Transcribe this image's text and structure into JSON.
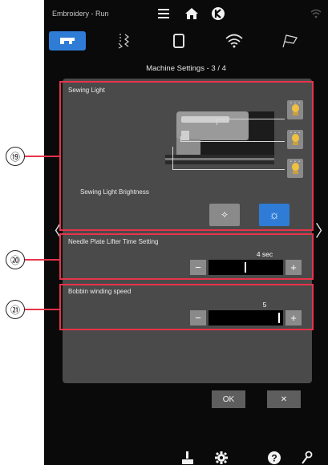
{
  "title_bar": {
    "title": "Embroidery - Run",
    "icons": [
      "menu-icon",
      "home-icon",
      "stop-sign-icon",
      "wifi-icon"
    ]
  },
  "tabs": [
    {
      "name": "sewing-machine-icon",
      "active": true
    },
    {
      "name": "stitch-icon",
      "active": false
    },
    {
      "name": "hoop-icon",
      "active": false
    },
    {
      "name": "wifi-icon",
      "active": false
    },
    {
      "name": "flag-icon",
      "active": false
    }
  ],
  "page": {
    "subtitle": "Machine Settings  -  3 / 4"
  },
  "sewing_light": {
    "title": "Sewing Light",
    "brightness_label": "Sewing Light Brightness",
    "bulb_icons": [
      "light-bulb-icon",
      "light-bulb-icon",
      "light-bulb-icon"
    ],
    "brightness_options": [
      {
        "name": "dim-brightness-icon",
        "glyph": "✧",
        "selected": false
      },
      {
        "name": "bright-brightness-icon",
        "glyph": "☼",
        "selected": true
      }
    ]
  },
  "needle_plate": {
    "title": "Needle Plate Lifter Time Setting",
    "value": "4 sec",
    "minus": "−",
    "plus": "+"
  },
  "bobbin": {
    "title": "Bobbin winding speed",
    "value": "5",
    "minus": "−",
    "plus": "+"
  },
  "actions": {
    "ok_label": "OK",
    "cancel_label": "✕"
  },
  "nav": {
    "prev": "〈",
    "next": "〉"
  },
  "callouts": {
    "c19": "⑲",
    "c20": "⑳",
    "c21": "㉑"
  },
  "bottom_icons": [
    "thread-cutter-icon",
    "settings-gear-icon",
    "help-icon",
    "tools-icon"
  ],
  "colors": {
    "accent": "#2f7cd6",
    "background": "#0a0a0a",
    "panel": "#4a4a4a",
    "callout_red": "#e8334a",
    "bulb": "#f0c040"
  }
}
